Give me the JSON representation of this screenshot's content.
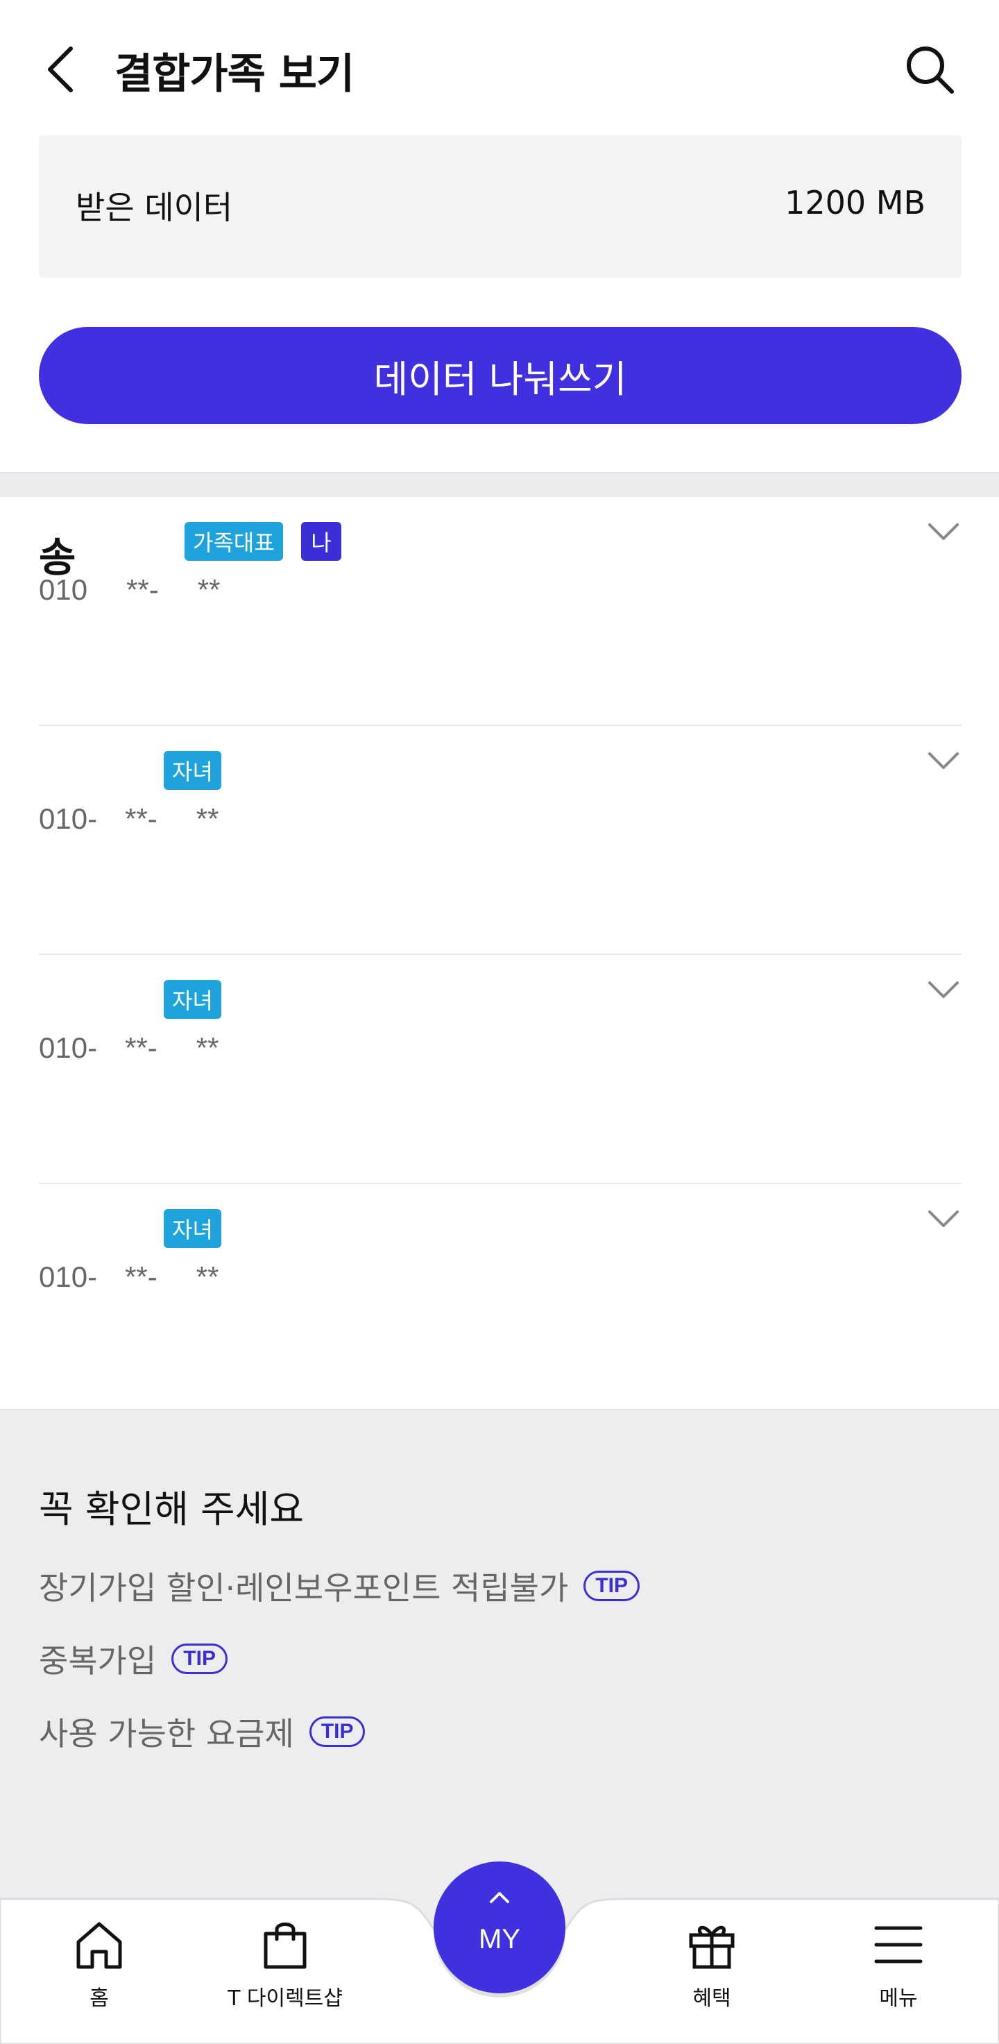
{
  "header": {
    "title": "결합가족 보기",
    "back_icon": "chevron-left-icon",
    "search_icon": "search-icon"
  },
  "received": {
    "label": "받은 데이터",
    "value": "1200 MB"
  },
  "share_button": {
    "label": "데이터 나눠쓰기",
    "color": "#4130e0"
  },
  "members": [
    {
      "name": "송",
      "badges": [
        "가족대표",
        "나"
      ],
      "phone_prefix": "010",
      "mask1": "**-",
      "mask2": "**"
    },
    {
      "name": "",
      "badges": [
        "자녀"
      ],
      "phone_prefix": "010-",
      "mask1": "**-",
      "mask2": "**"
    },
    {
      "name": "",
      "badges": [
        "자녀"
      ],
      "phone_prefix": "010-",
      "mask1": "**-",
      "mask2": "**"
    },
    {
      "name": "",
      "badges": [
        "자녀"
      ],
      "phone_prefix": "010-",
      "mask1": "**-",
      "mask2": "**"
    }
  ],
  "notice": {
    "title": "꼭 확인해 주세요",
    "items": [
      {
        "label": "장기가입 할인·레인보우포인트 적립불가",
        "tip": "TIP"
      },
      {
        "label": "중복가입",
        "tip": "TIP"
      },
      {
        "label": "사용 가능한 요금제",
        "tip": "TIP"
      }
    ]
  },
  "bottom_nav": {
    "home": "홈",
    "direct_shop": "T 다이렉트샵",
    "my": "MY",
    "benefits": "혜택",
    "menu": "메뉴"
  },
  "colors": {
    "primary": "#4130e0",
    "badge_blue": "#1fa3dc",
    "badge_me": "#3b2ed6"
  }
}
